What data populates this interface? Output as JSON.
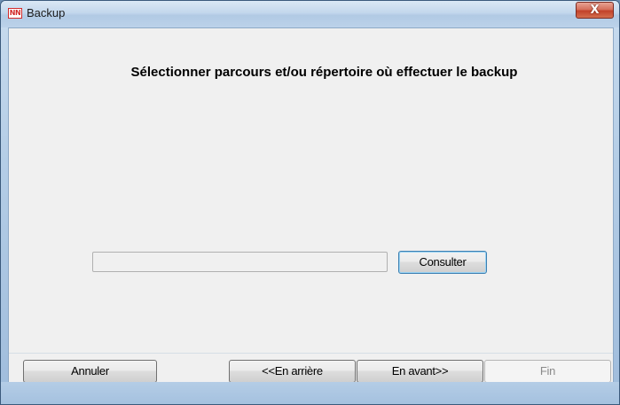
{
  "window": {
    "title": "Backup",
    "icon_label": "NN",
    "close_glyph": "X"
  },
  "main": {
    "heading": "Sélectionner parcours et/ou répertoire où effectuer le backup",
    "path_input": {
      "value": "",
      "placeholder": ""
    },
    "consulter_label": "Consulter"
  },
  "footer": {
    "cancel_label": "Annuler",
    "back_label": "<<En arrière",
    "forward_label": "En avant>>",
    "finish_label": "Fin"
  },
  "colors": {
    "client_bg": "#f0f0f0",
    "frame": "#b4cde6",
    "close_button": "#c2412a",
    "focus_border": "#3c7fb1"
  }
}
